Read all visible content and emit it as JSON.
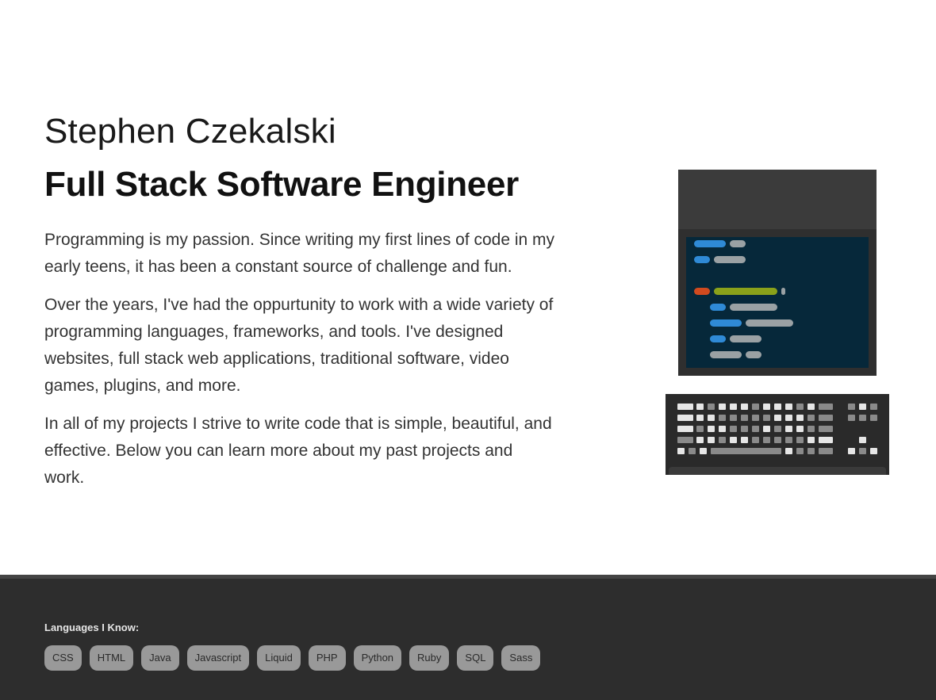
{
  "hero": {
    "name": "Stephen Czekalski",
    "role": "Full Stack Software Engineer",
    "paragraphs": [
      "Programming is my passion. Since writing my first lines of code in my early teens, it has been a constant source of challenge and fun.",
      "Over the years, I've had the oppurtunity to work with a wide variety of programming languages, frameworks, and tools. I've designed websites, full stack web applications, traditional software, video games, plugins, and more.",
      "In all of my projects I strive to write code that is simple, beautiful, and effective. Below you can learn more about my past projects and work."
    ]
  },
  "illustration": {
    "icon": "computer-monitor-keyboard-illustration",
    "colors": {
      "screen": "#06283a",
      "blue": "#2f8ad6",
      "gray": "#9aa1a4",
      "red": "#d04a1f",
      "green": "#8aa11a"
    }
  },
  "footer": {
    "heading": "Languages I Know:",
    "languages": [
      "CSS",
      "HTML",
      "Java",
      "Javascript",
      "Liquid",
      "PHP",
      "Python",
      "Ruby",
      "SQL",
      "Sass"
    ]
  }
}
